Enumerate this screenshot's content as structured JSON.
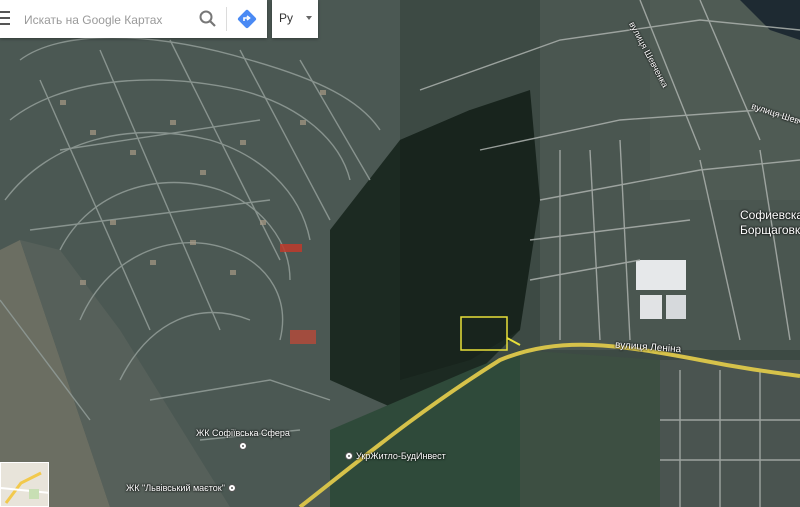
{
  "search": {
    "placeholder": "Искать на Google Картах",
    "menu_icon": "hamburger-menu-icon",
    "search_icon": "magnifier-icon",
    "directions_icon": "directions-icon"
  },
  "language": {
    "label": "Ру"
  },
  "map": {
    "streets": {
      "lenina": "вулиця Леніна",
      "shevchenka_top": "вулиця Шевченка",
      "shevchenka_right": "вулиця Шевченка"
    },
    "places": {
      "town_line1": "Софиевская",
      "town_line2": "Борщаговка"
    },
    "pois": [
      {
        "label": "ЖК Софіївська Сфера"
      },
      {
        "label": "УкрЖитло-БудИнвест"
      },
      {
        "label": "ЖК \"Львівський маєток\""
      }
    ],
    "colors": {
      "road_yellow": "#d6c24a",
      "highlight_box": "#e8e03a",
      "forest": "#1c2a22",
      "field": "#3a4a3f"
    }
  },
  "minimap": {
    "label": ""
  }
}
